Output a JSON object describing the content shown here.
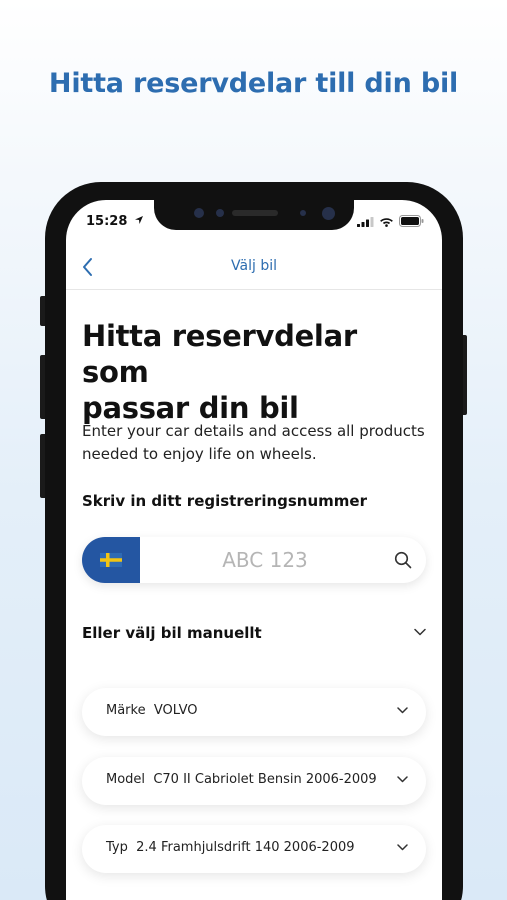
{
  "promo": {
    "headline": "Hitta reservdelar till din bil"
  },
  "status": {
    "time": "15:28"
  },
  "nav": {
    "title": "Välj bil"
  },
  "content": {
    "heading_line1": "Hitta reservdelar som",
    "heading_line2": "passar din bil",
    "intro_line1": "Enter your car details and access all products",
    "intro_line2": "needed to enjoy life on wheels.",
    "reg_label": "Skriv in ditt registreringsnummer",
    "plate_placeholder": "ABC 123",
    "manual_label": "Eller välj bil manuellt"
  },
  "selects": [
    {
      "label": "Märke",
      "value": "VOLVO"
    },
    {
      "label": "Model",
      "value": "C70 II Cabriolet Bensin  2006-2009"
    },
    {
      "label": "Typ",
      "value": "2.4 Framhjulsdrift 140 2006-2009"
    }
  ],
  "icons": {
    "back": "chevron-left-icon",
    "search": "search-icon",
    "chevron": "chevron-down-icon",
    "flag": "sweden-flag-icon",
    "location": "location-arrow-icon",
    "signal": "signal-icon",
    "wifi": "wifi-icon",
    "battery": "battery-icon"
  },
  "colors": {
    "accent": "#2d6db0",
    "plate_blue": "#2456a2",
    "flag_blue": "#2e6bb5",
    "flag_yellow": "#f2c413"
  }
}
